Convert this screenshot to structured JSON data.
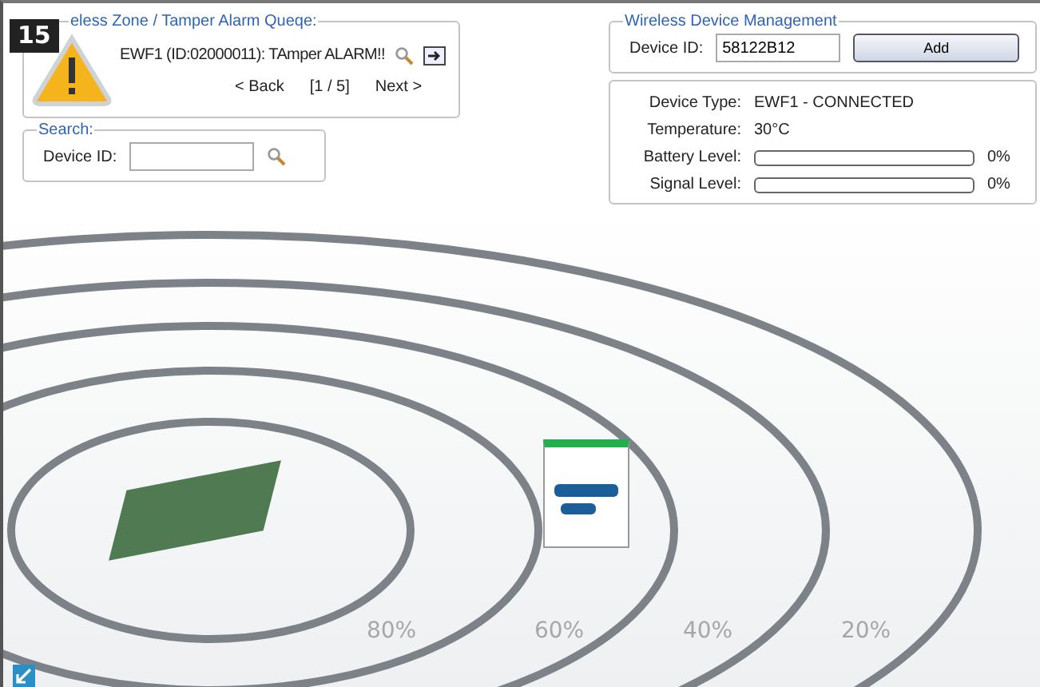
{
  "badge": "15",
  "alarm_queue": {
    "title": "eless Zone / Tamper Alarm Queqe:",
    "message": "EWF1 (ID:02000011): TAmper ALARM!!",
    "back": "< Back",
    "position": "[1 / 5]",
    "next": "Next >"
  },
  "search": {
    "title": "Search:",
    "label": "Device ID:"
  },
  "management": {
    "title": "Wireless Device Management",
    "label": "Device ID:",
    "value": "58122B12",
    "button": "Add"
  },
  "details": [
    {
      "kind": "text",
      "label": "Device Type:",
      "value": "EWF1 - CONNECTED"
    },
    {
      "kind": "text",
      "label": "Temperature:",
      "value": "30°C"
    },
    {
      "kind": "bar",
      "label": "Battery Level:",
      "level": 0,
      "reading": "0%"
    },
    {
      "kind": "bar",
      "label": "Signal Level:",
      "level": 0,
      "reading": "0%"
    }
  ],
  "rings": [
    "80%",
    "60%",
    "40%",
    "20%"
  ]
}
